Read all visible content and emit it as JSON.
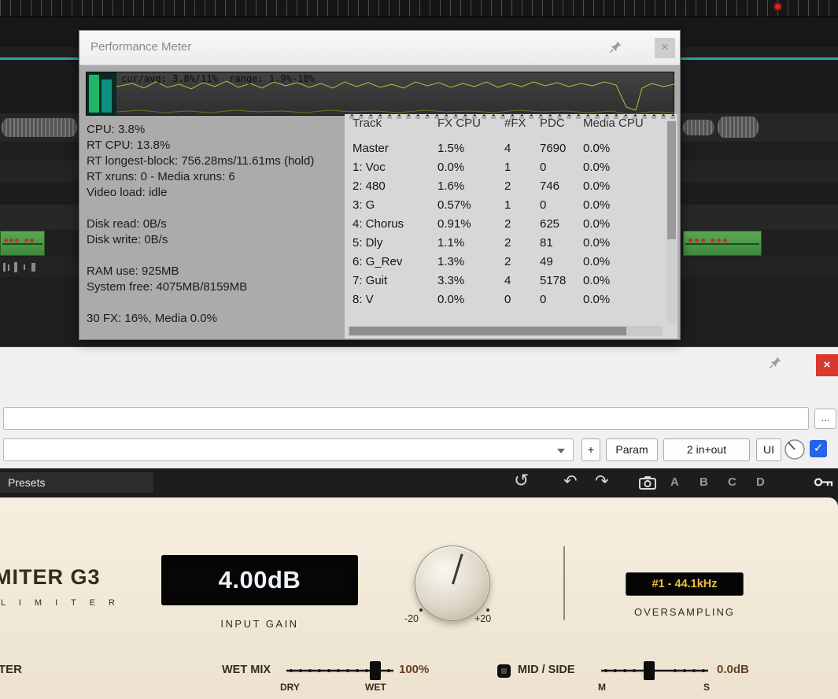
{
  "colors": {
    "timeline_accent_teal": "#2da6a0",
    "marker_red": "#d12a21",
    "close_red": "#d8382e",
    "fx_check_blue": "#2563e8",
    "media_item_green": "#4f9f48",
    "lcd_value_white": "#edf2fa",
    "oversampling_gold": "#e8c23c",
    "plugin_value_brown": "#693f27",
    "plugin_background_cream": "#f1e9d8"
  },
  "icons": {
    "close_glyph": "×",
    "check_glyph": "✓",
    "history_glyph": "↺",
    "undo_glyph": "↶",
    "redo_glyph": "↷"
  },
  "perf": {
    "title": "Performance Meter",
    "graph_label": "cur/avg: 3.8%/11%  range: 1.9%-18%",
    "stats": [
      "CPU: 3.8%",
      "RT CPU: 13.8%",
      "RT longest-block: 756.28ms/11.61ms (hold)",
      "RT xruns: 0 - Media xruns: 6",
      "Video load: idle",
      "",
      "Disk read: 0B/s",
      "Disk write: 0B/s",
      "",
      "RAM use: 925MB",
      "System free: 4075MB/8159MB",
      "",
      "30 FX: 16%, Media 0.0%"
    ],
    "table": {
      "headers": [
        "Track",
        "FX CPU",
        "#FX",
        "PDC",
        "Media CPU"
      ],
      "rows": [
        [
          "Master",
          "1.5%",
          "4",
          "7690",
          "0.0%"
        ],
        [
          "1: Voc",
          "0.0%",
          "1",
          "0",
          "0.0%"
        ],
        [
          "2: 480",
          "1.6%",
          "2",
          "746",
          "0.0%"
        ],
        [
          "3: G",
          "0.57%",
          "1",
          "0",
          "0.0%"
        ],
        [
          "4: Chorus",
          "0.91%",
          "2",
          "625",
          "0.0%"
        ],
        [
          "5: Dly",
          "1.1%",
          "2",
          "81",
          "0.0%"
        ],
        [
          "6: G_Rev",
          "1.3%",
          "2",
          "49",
          "0.0%"
        ],
        [
          "7: Guit",
          "3.3%",
          "4",
          "5178",
          "0.0%"
        ],
        [
          "8: V",
          "0.0%",
          "0",
          "0",
          "0.0%"
        ]
      ]
    }
  },
  "fx": {
    "more_button": "...",
    "plus_button": "+",
    "param_button": "Param",
    "io_button": "2 in+out",
    "ui_button": "UI"
  },
  "presets": {
    "label": "Presets",
    "slots": [
      "A",
      "B",
      "C",
      "D"
    ]
  },
  "plugin": {
    "brand_line1": "MITER G3",
    "brand_line2": "L I M I T E R",
    "input_gain_value": "4.00dB",
    "input_gain_label": "INPUT GAIN",
    "knob_min_label": "-20",
    "knob_max_label": "+20",
    "oversampling_value": "#1 - 44.1kHz",
    "oversampling_label": "OVERSAMPLING",
    "meter_label": "TER",
    "wet_mix_label": "WET MIX",
    "wet_mix_value": "100%",
    "dry_label": "DRY",
    "wet_label": "WET",
    "midside_label": "MID / SIDE",
    "m_label": "M",
    "s_label": "S",
    "midside_value": "0.0dB"
  }
}
